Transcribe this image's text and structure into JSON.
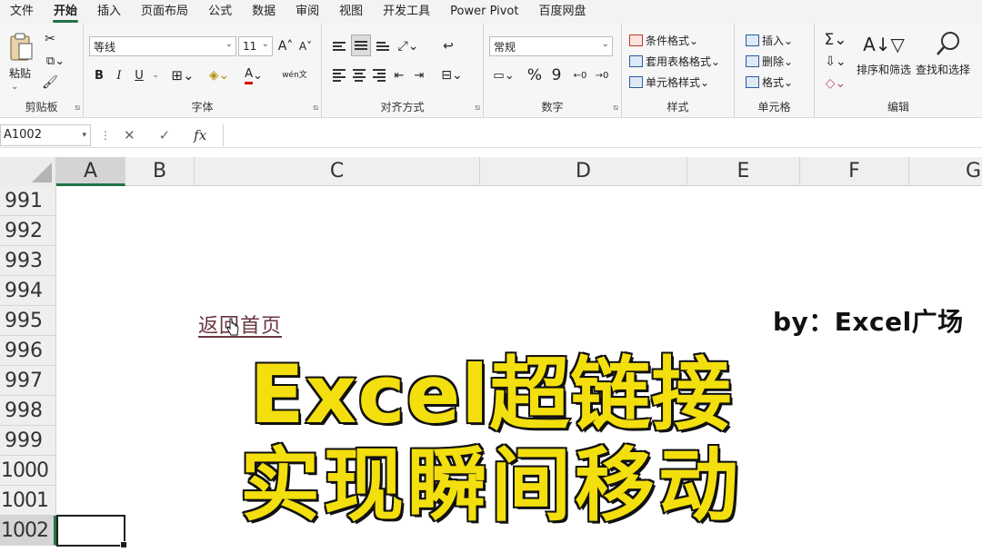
{
  "menu": {
    "tabs": [
      "文件",
      "开始",
      "插入",
      "页面布局",
      "公式",
      "数据",
      "审阅",
      "视图",
      "开发工具",
      "Power Pivot",
      "百度网盘"
    ],
    "active_index": 1
  },
  "ribbon": {
    "clipboard": {
      "label": "剪贴板",
      "paste": "粘贴"
    },
    "font": {
      "label": "字体",
      "name": "等线",
      "size": "11",
      "bold": "B",
      "italic": "I",
      "underline": "U",
      "grow": "A˄",
      "shrink": "A˅",
      "font_color": "A",
      "phonetic": "wén文"
    },
    "alignment": {
      "label": "对齐方式"
    },
    "number": {
      "label": "数字",
      "format": "常规",
      "percent": "%",
      "comma": "9"
    },
    "styles": {
      "label": "样式",
      "conditional": "条件格式",
      "table": "套用表格格式",
      "cell": "单元格样式"
    },
    "cells": {
      "label": "单元格",
      "insert": "插入",
      "delete": "删除",
      "format": "格式"
    },
    "editing": {
      "label": "编辑",
      "sort": "排序和筛选",
      "find": "查找和选择"
    }
  },
  "formula_bar": {
    "name_box": "A1002",
    "cancel": "✕",
    "enter": "✓",
    "fx": "fx",
    "value": ""
  },
  "sheet": {
    "columns": [
      "A",
      "B",
      "C",
      "D",
      "E",
      "F",
      "G"
    ],
    "selected_column": "A",
    "rows": [
      "991",
      "992",
      "993",
      "994",
      "995",
      "996",
      "997",
      "998",
      "999",
      "1000",
      "1001",
      "1002"
    ],
    "selected_row": "1002",
    "link_text": "返回首页",
    "byline": "by：Excel广场"
  },
  "overlay": {
    "line1": "Excel超链接",
    "line2": "实现瞬间移动",
    "text_color": "#f3df0d",
    "stroke_color": "#111111"
  },
  "colors": {
    "accent": "#217346",
    "header_bg": "#efefef",
    "ribbon_bg": "#f6f6f6"
  }
}
